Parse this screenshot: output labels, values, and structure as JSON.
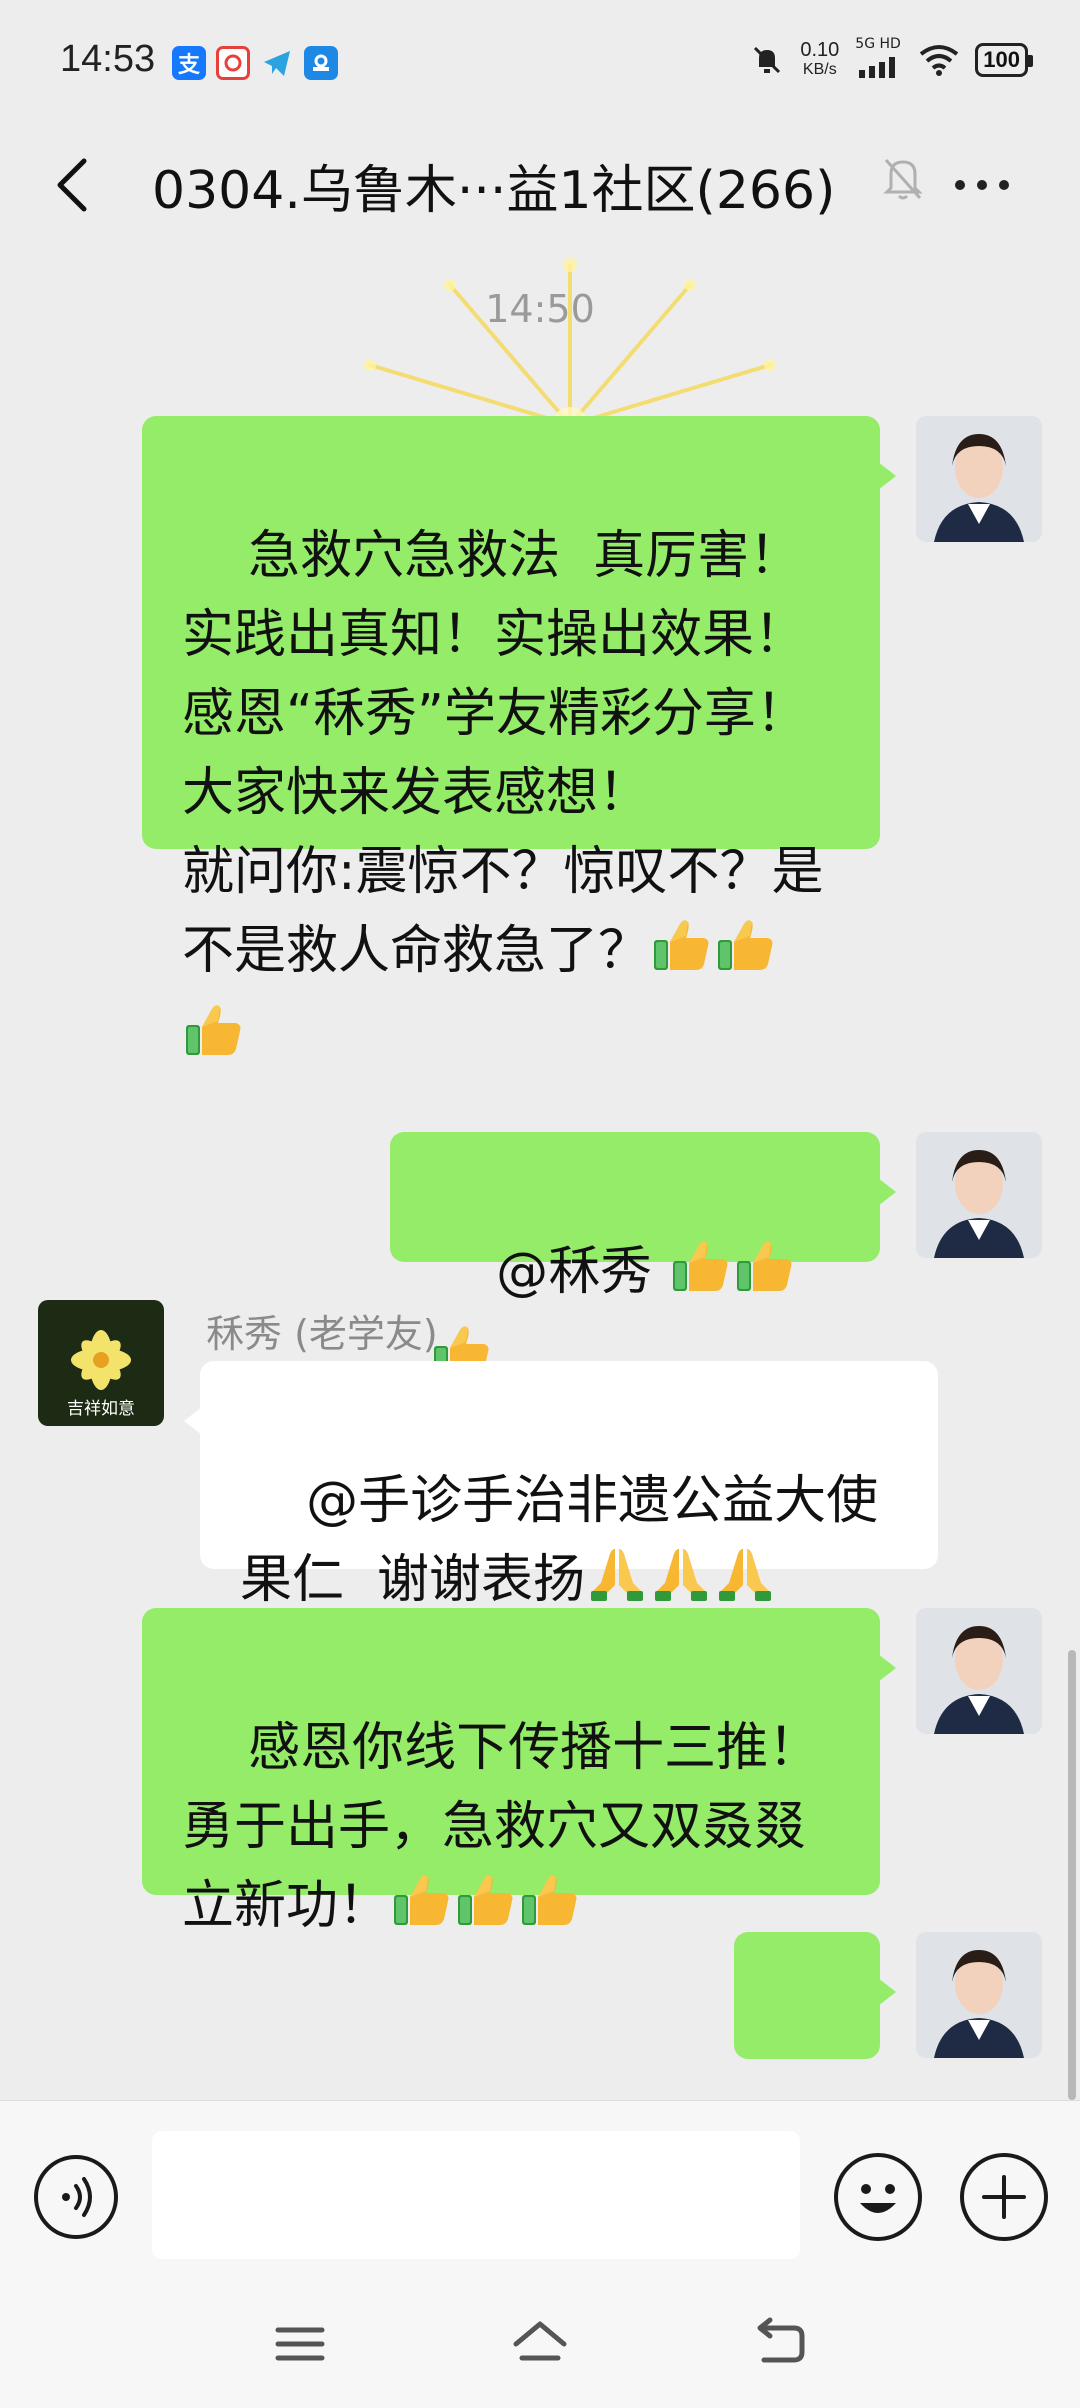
{
  "status_bar": {
    "time": "14:53",
    "apps": [
      {
        "icon": "alipay-icon",
        "glyph": "支",
        "color": "#1677ff"
      },
      {
        "icon": "app-icon",
        "glyph": "",
        "color": "#e8403a"
      },
      {
        "icon": "telegram-icon",
        "glyph": "",
        "color": "#2aa3e0"
      },
      {
        "icon": "app2-icon",
        "glyph": "",
        "color": "#1e88e5"
      }
    ],
    "net_speed_value": "0.10",
    "net_speed_unit": "KB/s",
    "network_label": "5G HD",
    "battery": "100"
  },
  "header": {
    "title": "0304.乌鲁木···益1社区(266)"
  },
  "chat": {
    "timestamp": "14:50",
    "messages": [
      {
        "side": "out",
        "text": "急救穴急救法  真厉害！实践出真知！实操出效果！感恩“秝秀”学友精彩分享！大家快来发表感想！\n就问你:震惊不？惊叹不？是不是救人命救急了？",
        "emoji": [
          "thumbs-up",
          "thumbs-up",
          "thumbs-up"
        ]
      },
      {
        "side": "out",
        "text": "@秝秀 ",
        "emoji": [
          "thumbs-up",
          "thumbs-up",
          "thumbs-up"
        ]
      },
      {
        "side": "in",
        "sender": "秝秀 (老学友)",
        "avatar_text": "吉祥如意",
        "text": "@手诊手治非遗公益大使果仁  谢谢表扬",
        "emoji": [
          "pray",
          "pray",
          "pray"
        ]
      },
      {
        "side": "out",
        "text": "感恩你线下传播十三推！勇于出手，急救穴又双叒叕立新功！",
        "emoji": [
          "thumbs-up",
          "thumbs-up",
          "thumbs-up"
        ]
      },
      {
        "side": "out",
        "text": "",
        "emoji": [
          "fireworks"
        ]
      }
    ]
  },
  "colors": {
    "bubble_out": "#95ec69",
    "bubble_in": "#ffffff",
    "background": "#ededed"
  }
}
